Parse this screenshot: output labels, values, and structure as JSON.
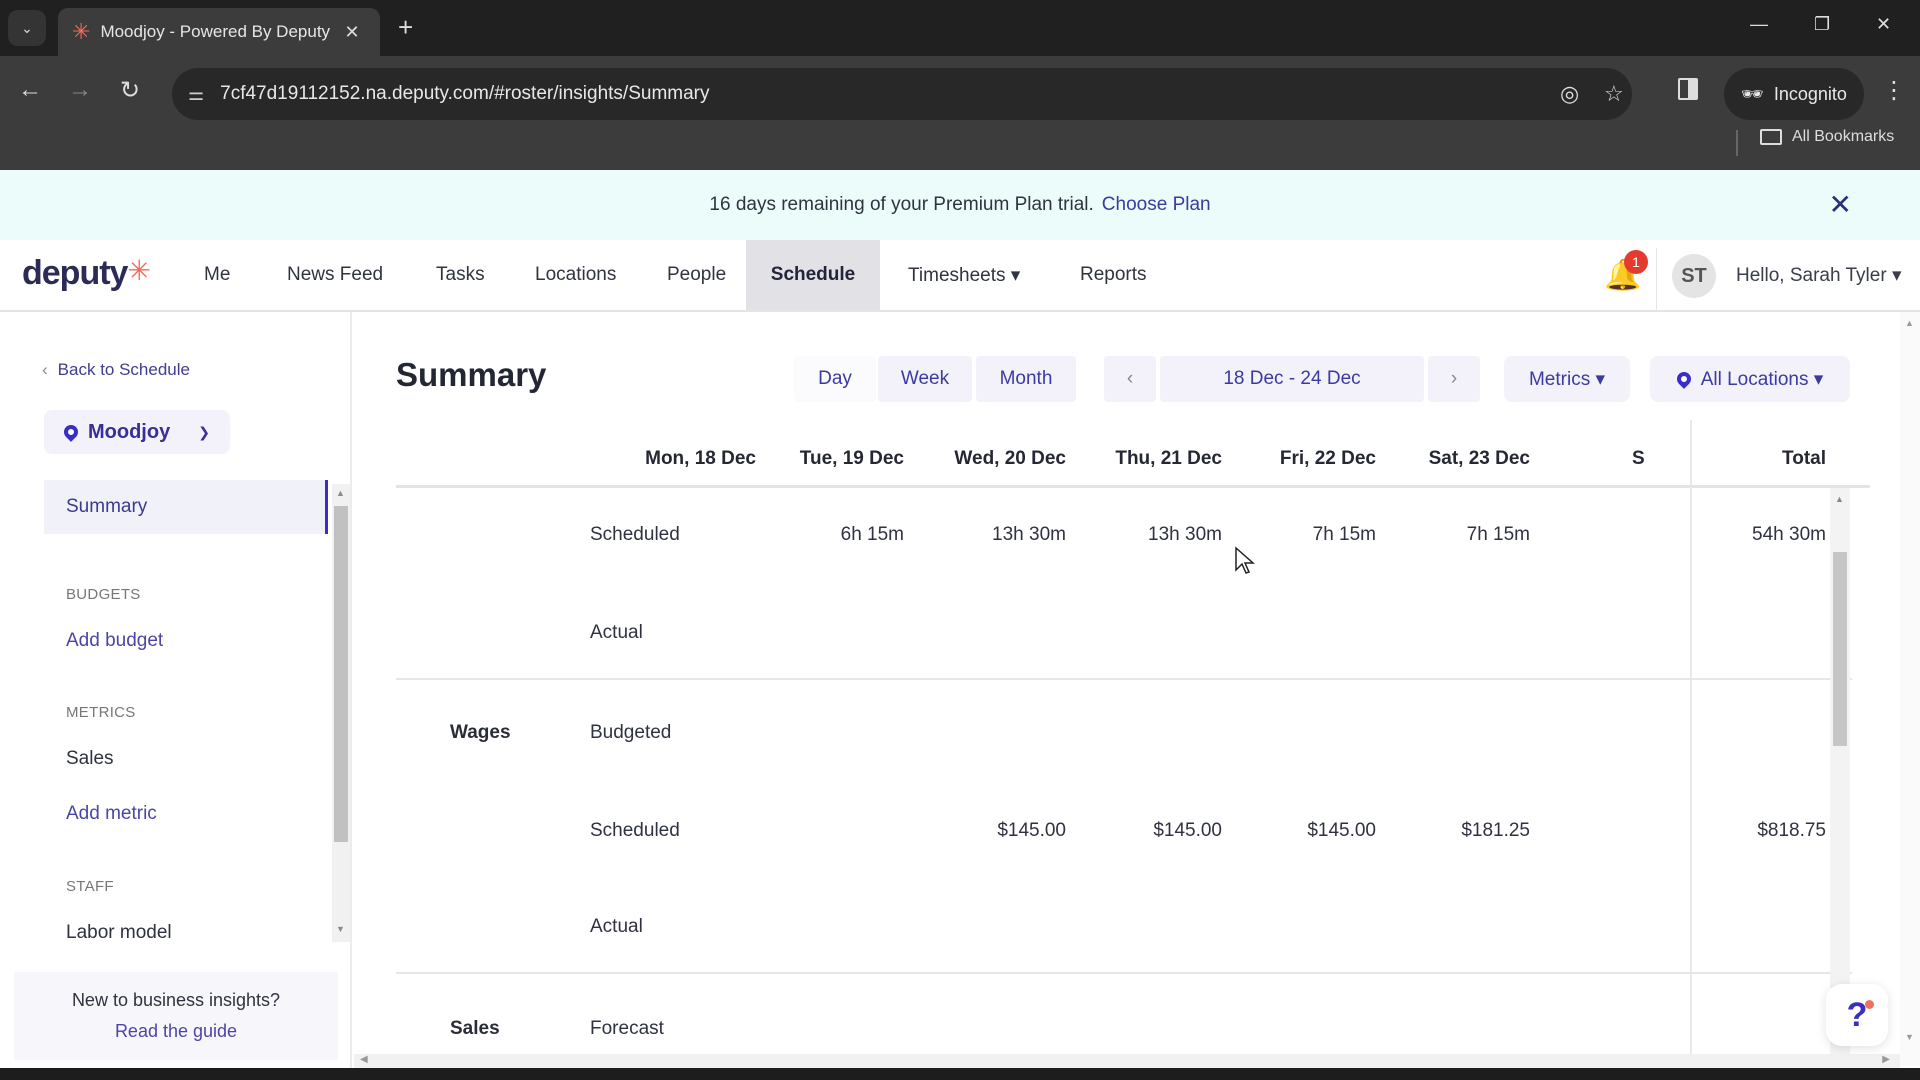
{
  "browser": {
    "tab_title": "Moodjoy - Powered By Deputy",
    "url": "7cf47d19112152.na.deputy.com/#roster/insights/Summary",
    "incognito_label": "Incognito",
    "bookmarks_label": "All Bookmarks",
    "icons": [
      "tab-search-icon",
      "deputy-favicon",
      "close-icon",
      "plus-icon",
      "minimize-icon",
      "restore-icon",
      "window-close-icon",
      "back-icon",
      "forward-icon",
      "reload-icon",
      "site-settings-icon",
      "eye-off-icon",
      "star-icon",
      "side-panel-icon",
      "incognito-icon",
      "more-vert-icon",
      "folder-icon"
    ]
  },
  "banner": {
    "message": "16 days remaining of your Premium Plan trial.",
    "cta": "Choose Plan",
    "close": "✕"
  },
  "nav": {
    "logo": "deputy",
    "items": [
      {
        "label": "Me",
        "active": false
      },
      {
        "label": "News Feed",
        "active": false
      },
      {
        "label": "Tasks",
        "active": false
      },
      {
        "label": "Locations",
        "active": false
      },
      {
        "label": "People",
        "active": false
      },
      {
        "label": "Schedule",
        "active": true
      },
      {
        "label": "Timesheets ▾",
        "active": false
      },
      {
        "label": "Reports",
        "active": false
      }
    ],
    "notification_count": "1",
    "avatar_initials": "ST",
    "greeting": "Hello, Sarah Tyler ▾"
  },
  "sidebar": {
    "back_label": "Back to Schedule",
    "location": "Moodjoy",
    "active_item": "Summary",
    "sections": [
      {
        "heading": "BUDGETS",
        "items": [
          {
            "label": "Add budget",
            "type": "link"
          }
        ]
      },
      {
        "heading": "METRICS",
        "items": [
          {
            "label": "Sales",
            "type": "item"
          },
          {
            "label": "Add metric",
            "type": "link"
          }
        ]
      },
      {
        "heading": "STAFF",
        "items": [
          {
            "label": "Labor model",
            "type": "item"
          }
        ]
      }
    ],
    "guide_prompt": "New to business insights?",
    "guide_link": "Read the guide"
  },
  "main": {
    "title": "Summary",
    "views": [
      "Day",
      "Week",
      "Month"
    ],
    "date_range": "18 Dec - 24 Dec",
    "prev": "‹",
    "next": "›",
    "metrics_label": "Metrics ▾",
    "locations_label": "All Locations ▾",
    "columns": [
      "Mon, 18 Dec",
      "Tue, 19 Dec",
      "Wed, 20 Dec",
      "Thu, 21 Dec",
      "Fri, 22 Dec",
      "Sat, 23 Dec",
      "S",
      "Total"
    ],
    "rows": [
      {
        "group": "",
        "label": "Scheduled",
        "values": [
          "",
          "6h 15m",
          "13h 30m",
          "13h 30m",
          "7h 15m",
          "7h 15m",
          "",
          "54h 30m"
        ]
      },
      {
        "group": "",
        "label": "Actual",
        "values": [
          "",
          "",
          "",
          "",
          "",
          "",
          "",
          ""
        ]
      },
      {
        "group": "Wages",
        "label": "Budgeted",
        "values": [
          "",
          "",
          "",
          "",
          "",
          "",
          "",
          ""
        ]
      },
      {
        "group": "",
        "label": "Scheduled",
        "values": [
          "",
          "",
          "$145.00",
          "$145.00",
          "$145.00",
          "$181.25",
          "",
          "$818.75"
        ]
      },
      {
        "group": "",
        "label": "Actual",
        "values": [
          "",
          "",
          "",
          "",
          "",
          "",
          "",
          ""
        ]
      },
      {
        "group": "Sales",
        "label": "Forecast",
        "values": [
          "",
          "",
          "",
          "",
          "",
          "",
          "",
          ""
        ]
      }
    ]
  },
  "help_label": "?"
}
